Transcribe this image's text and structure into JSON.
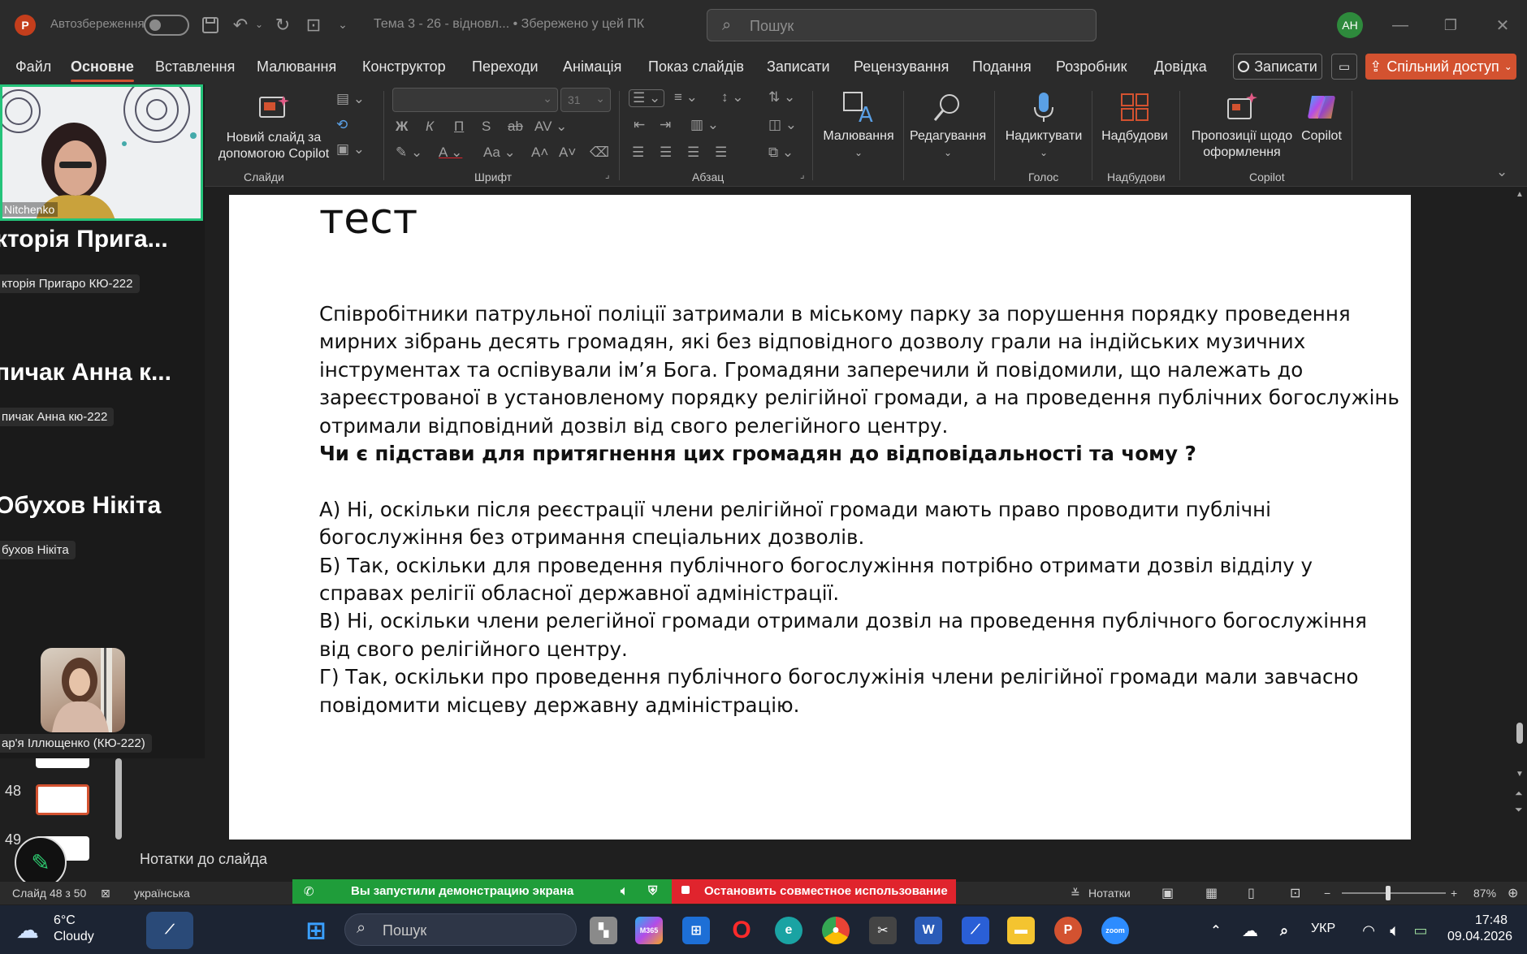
{
  "titlebar": {
    "autosave_label": "Автозбереження",
    "doc_title": "Тема 3 - 26  -  відновл...  • Збережено у цей ПК",
    "search_placeholder": "Пошук",
    "avatar_initials": "АН"
  },
  "menu": {
    "tabs": [
      "Файл",
      "Основне",
      "Вставлення",
      "Малювання",
      "Конструктор",
      "Переходи",
      "Анімація",
      "Показ слайдів",
      "Записати",
      "Рецензування",
      "Подання",
      "Розробник",
      "Довідка"
    ],
    "active_tab": "Основне",
    "record_label": "Записати",
    "share_label": "Спільний доступ"
  },
  "ribbon": {
    "new_slide_copilot": "Новий слайд за\nдопомогою Copilot",
    "font_size": "31",
    "drawing": "Малювання",
    "editing": "Редагування",
    "dictate": "Надиктувати",
    "addins": "Надбудови",
    "design_ideas": "Пропозиції щодо\nоформлення",
    "copilot": "Copilot",
    "groups": {
      "slides": "Слайди",
      "font": "Шрифт",
      "paragraph": "Абзац",
      "voice": "Голос",
      "addins": "Надбудови",
      "copilot": "Copilot"
    }
  },
  "participants": {
    "speaker_name": "Nitchenko",
    "p1_big": "кторія Прига...",
    "p1_small": "кторія Пригаро КЮ-222",
    "p2_big": "пичак Анна к...",
    "p2_small": "пичак Анна кю-222",
    "p3_big": "Обухов Нікіта",
    "p3_small": "бухов Нікіта",
    "p4_small": "ар'я Іллющенко (КЮ-222)"
  },
  "thumbs": {
    "n48": "48",
    "n49": "49"
  },
  "slide": {
    "title": "тест",
    "paragraph": "Співробітники патрульної поліції затримали в міському парку за порушення порядку проведення мирних зібрань десять громадян, які без відповідного дозволу грали на індійських музичних інструментах та оспівували ім’я Бога. Громадяни заперечили й повідомили, що належать до зареєстрованої в установленому порядку релігійної громади, а на проведення публічних богослужінь отримали відповідний дозвіл від свого релегійного центру.",
    "question": "Чи є підстави для притягнення цих громадян до відповідальності та чому ?",
    "answer_a": "А) Ні, оскільки після реєстрації члени релігійної громади мають право проводити публічні богослужіння без отримання спеціальних дозволів.",
    "answer_b": "Б) Так, оскільки для проведення публічного богослужіння потрібно отримати дозвіл відділу у справах релігії обласної державної адміністрації.",
    "answer_c": "В) Ні, оскільки члени релегійної громади отримали дозвіл на проведення публічного богослужіння від свого релігійного центру.",
    "answer_d": "Г) Так, оскільки про проведення публічного богослужінія члени релігійної громади мали завчасно повідомити місцеву державну адміністрацію."
  },
  "notes": {
    "label": "Нотатки до слайда"
  },
  "status": {
    "slide_counter": "Слайд 48 з 50",
    "language": "українська",
    "share_started": "Вы запустили демонстрацию экрана",
    "stop_sharing": "Остановить совместное использование",
    "notes_btn": "Нотатки",
    "zoom": "87%"
  },
  "taskbar": {
    "temp": "6°C",
    "weather": "Cloudy",
    "search": "Пошук",
    "lang": "УКР",
    "time": "17:48",
    "date": "09.04.2026"
  },
  "colors": {
    "accent": "#d35230",
    "zoom_green": "#24c37a",
    "share_green": "#1f9d3a",
    "stop_red": "#e0242d"
  }
}
